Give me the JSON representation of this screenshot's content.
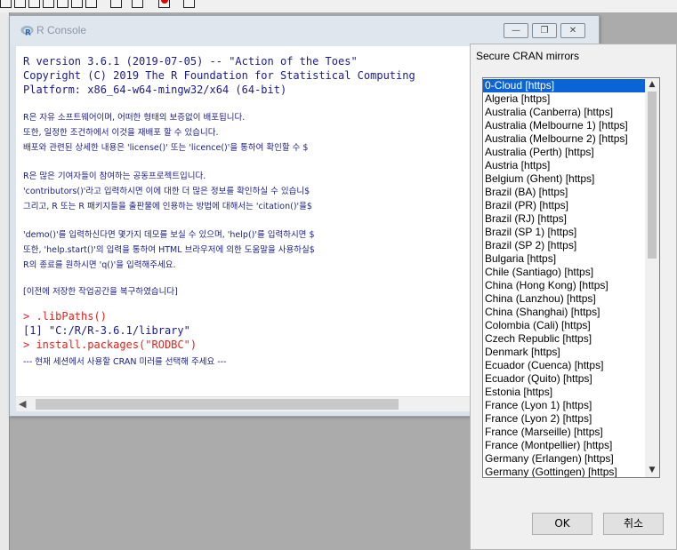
{
  "console": {
    "title": "R Console",
    "minimize_glyph": "—",
    "restore_glyph": "❐",
    "close_glyph": "✕",
    "lines": [
      "R version 3.6.1 (2019-07-05) -- \"Action of the Toes\"",
      "Copyright (C) 2019 The R Foundation for Statistical Computing",
      "Platform: x86_64-w64-mingw32/x64 (64-bit)",
      "R은 자유 소프트웨어이며, 어떠한 형태의 보증없이 배포됩니다.",
      "또한, 일정한 조건하에서 이것을 재배포 할 수 있습니다.",
      "배포와 관련된 상세한 내용은 'license()' 또는 'licence()'을 통하여 확인할 수 $",
      "R은 많은 기여자들이 참여하는 공동프로젝트입니다.",
      "'contributors()'라고 입력하시면 이에 대한 더 많은 정보를 확인하실 수 있습니$",
      "그리고, R 또는 R 패키지들을 출판물에 인용하는 방법에 대해서는 'citation()'을$",
      "'demo()'를 입력하신다면 몇가지 데모를 보실 수 있으며, 'help()'를 입력하시면 $",
      "또한, 'help.start()'의 입력을 통하여 HTML 브라우저에 의한 도움말을 사용하실$",
      "R의 종료를 원하시면 'q()'을 입력해주세요.",
      "[이전에 저장한 작업공간을 복구하였습니다]",
      "> .libPaths()",
      "[1] \"C:/R/R-3.6.1/library\"",
      "> install.packages(\"RODBC\")",
      "--- 현재 세션에서 사용할 CRAN 미러를 선택해 주세요 ---"
    ]
  },
  "dialog": {
    "title": "Secure CRAN mirrors",
    "selected_index": 0,
    "mirrors": [
      "0-Cloud [https]",
      "Algeria [https]",
      "Australia (Canberra) [https]",
      "Australia (Melbourne 1) [https]",
      "Australia (Melbourne 2) [https]",
      "Australia (Perth) [https]",
      "Austria [https]",
      "Belgium (Ghent) [https]",
      "Brazil (BA) [https]",
      "Brazil (PR) [https]",
      "Brazil (RJ) [https]",
      "Brazil (SP 1) [https]",
      "Brazil (SP 2) [https]",
      "Bulgaria [https]",
      "Chile (Santiago) [https]",
      "China (Hong Kong) [https]",
      "China (Lanzhou) [https]",
      "China (Shanghai) [https]",
      "Colombia (Cali) [https]",
      "Czech Republic [https]",
      "Denmark [https]",
      "Ecuador (Cuenca) [https]",
      "Ecuador (Quito) [https]",
      "Estonia [https]",
      "France (Lyon 1) [https]",
      "France (Lyon 2) [https]",
      "France (Marseille) [https]",
      "France (Montpellier) [https]",
      "Germany (Erlangen) [https]",
      "Germany (Gottingen) [https]"
    ],
    "ok_label": "OK",
    "cancel_label": "취소",
    "scroll_up_glyph": "▲",
    "scroll_down_glyph": "▼"
  },
  "colors": {
    "console_text": "#1b1b8a",
    "command_text": "#e8201a",
    "selection": "#0a64d8"
  }
}
